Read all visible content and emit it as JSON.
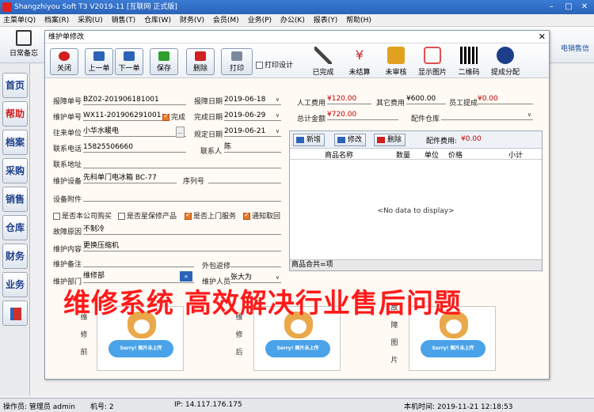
{
  "app": {
    "title": "Shangzhiyou Soft T3 V2019-11 [互联网 正式版]"
  },
  "menu": [
    "主菜单(Q)",
    "档案(R)",
    "采购(U)",
    "销售(T)",
    "仓库(W)",
    "财务(V)",
    "会员(M)",
    "业务(P)",
    "办公(K)",
    "报表(Y)",
    "帮助(H)"
  ],
  "maintool": {
    "daily": "日常备忘",
    "eshop": "电销售信"
  },
  "leftnav": [
    "首页",
    "帮助",
    "档案",
    "采购",
    "销售",
    "仓库",
    "财务",
    "业务"
  ],
  "dialog": {
    "title": "维护单修改",
    "toolbar": {
      "close": "关闭",
      "prev": "上一单",
      "next": "下一单",
      "save": "保存",
      "delete": "删除",
      "print": "打印",
      "print_design": "打印设计",
      "done": "已完成",
      "unpaid": "未结算",
      "unaudited": "未审核",
      "show_image": "显示图片",
      "qrcode": "二维码",
      "submit": "提成分配"
    },
    "form": {
      "bz_label": "报障单号",
      "bz_value": "BZ02-201906181001",
      "bzdate_label": "报障日期",
      "bzdate_value": "2019-06-18",
      "wx_label": "维护单号",
      "wx_value": "WX11-201906291001",
      "finish_label": "完成",
      "wcdate_label": "完成日期",
      "wcdate_value": "2019-06-29",
      "unit_label": "往来单位",
      "unit_value": "小华水暖电",
      "gddate_label": "规定日期",
      "gddate_value": "2019-06-21",
      "tel_label": "联系电话",
      "tel_value": "15825506660",
      "contact_label": "联系人",
      "contact_value": "陈",
      "addr_label": "联系地址",
      "device_label": "维护设备",
      "device_value": "先科单门电冰箱 BC-77",
      "serial_label": "序列号",
      "attach_label": "设备附件",
      "cb1": "是否本公司购买",
      "cb2": "是否星保修产品",
      "cb3": "是否上门服务",
      "cb4": "通知取回",
      "fault_label": "故障原因",
      "fault_value": "不制冷",
      "content_label": "维护内容",
      "content_value": "更换压缩机",
      "note_label": "维护备注",
      "outrepair_label": "外包返修",
      "dept_label": "维护部门",
      "dept_value": "维修部",
      "staff_label": "维护人员",
      "staff_value": "张大为",
      "labor_label": "人工费用",
      "labor_value": "¥120.00",
      "other_label": "其它费用",
      "other_value": "¥600.00",
      "comm_label": "员工提成",
      "comm_value": "¥0.00",
      "total_label": "总计金额",
      "total_value": "¥720.00",
      "wh_label": "配件仓库"
    },
    "grid": {
      "add": "新增",
      "edit": "修改",
      "del": "删除",
      "parts_fee_label": "配件费用:",
      "parts_fee_value": "¥0.00",
      "columns": [
        "商品名称",
        "数量",
        "单位",
        "价格",
        "小计"
      ],
      "empty": "<No data to display>",
      "footer": "商品合共=项"
    },
    "images": {
      "before": [
        "维",
        "修",
        "前"
      ],
      "after": [
        "维",
        "修",
        "后"
      ],
      "fault": [
        "故",
        "障",
        "图",
        "片"
      ],
      "cloud_text": "Sorry! 图片未上传"
    }
  },
  "banner": "维修系统 高效解决行业售后问题",
  "statusbar": {
    "operator": "操作员: 管理员 admin",
    "machine": "机号: 2",
    "ip": "IP: 14.117.176.175",
    "local_time": "本机时间: 2019-11-21 12:18:53"
  },
  "colors": {
    "accent": "#2b63b8",
    "red": "#ff1a1a",
    "orange": "#e87a2a"
  }
}
